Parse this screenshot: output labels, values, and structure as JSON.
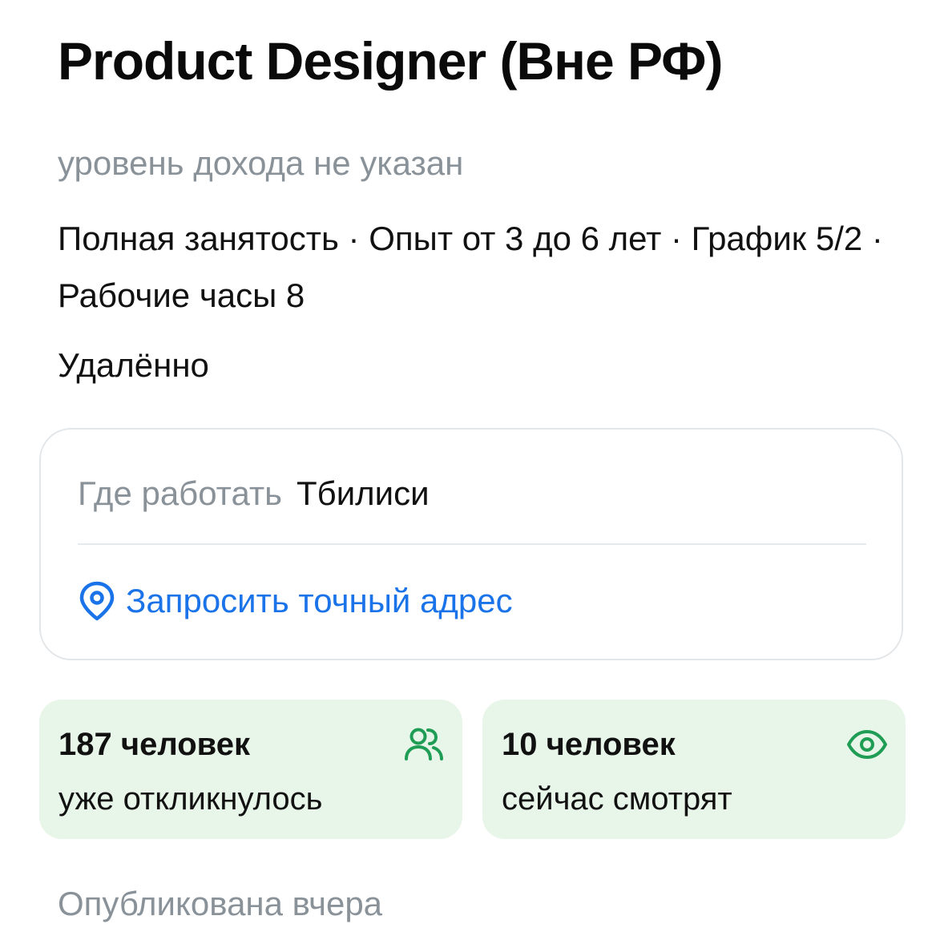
{
  "vacancy": {
    "title": "Product Designer (Вне РФ)",
    "salary": "уровень дохода не указан",
    "conditions": "Полная занятость · Опыт от 3 до 6 лет · График 5/2 · Рабочие часы 8",
    "work_format": "Удалённо"
  },
  "location": {
    "label": "Где работать",
    "city": "Тбилиси",
    "address_link": "Запросить точный адрес",
    "link_icon": "location-pin-icon"
  },
  "stats": {
    "responses": {
      "count": "187 человек",
      "description": "уже откликнулось",
      "icon": "people-icon"
    },
    "viewers": {
      "count": "10 человек",
      "description": "сейчас смотрят",
      "icon": "eye-icon"
    }
  },
  "published": "Опубликована вчера",
  "colors": {
    "accent_blue": "#1a73e8",
    "stat_green": "#1f9d55",
    "stat_bg": "#e8f5e9",
    "muted_text": "#8a9299"
  }
}
